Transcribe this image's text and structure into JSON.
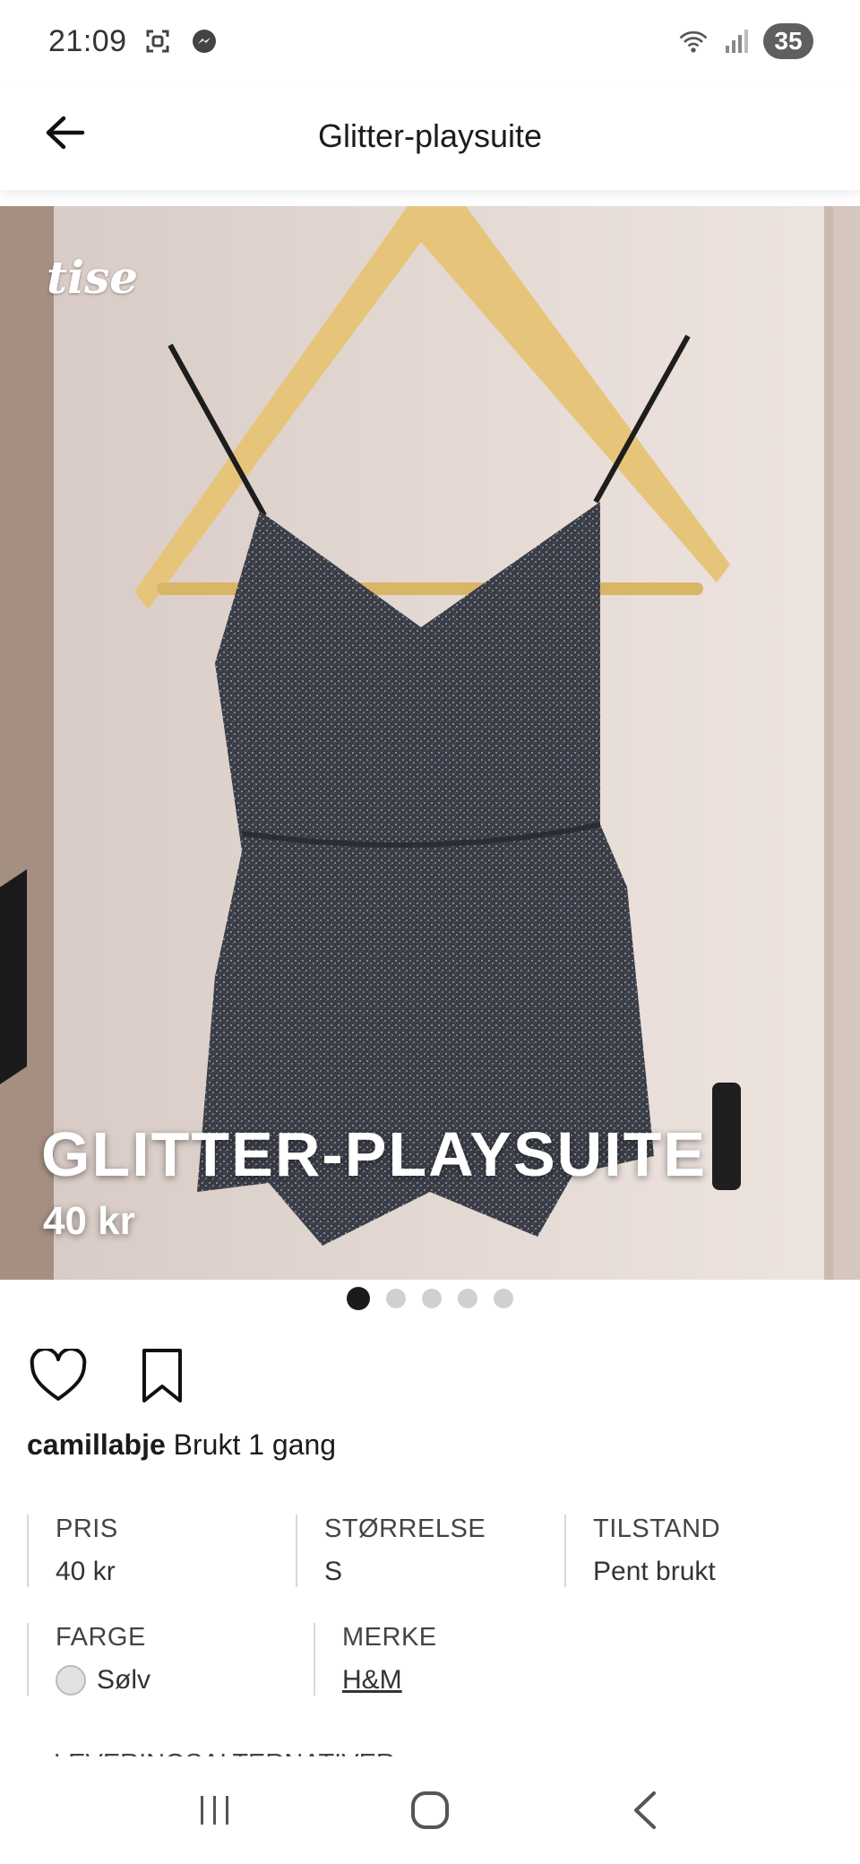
{
  "status_bar": {
    "time": "21:09",
    "battery": "35",
    "icons": [
      "screenshot-icon",
      "messenger-icon",
      "wifi-icon",
      "signal-icon"
    ]
  },
  "app_bar": {
    "title": "Glitter-playsuite",
    "back_icon": "arrow-left-icon"
  },
  "hero": {
    "watermark": "tise",
    "title": "GLITTER-PLAYSUITE",
    "price": "40 kr"
  },
  "carousel": {
    "count": 5,
    "active_index": 0
  },
  "actions": {
    "like_icon": "heart-icon",
    "save_icon": "bookmark-icon"
  },
  "seller": {
    "username": "camillabje",
    "note": "Brukt 1 gang"
  },
  "details": {
    "price": {
      "label": "PRIS",
      "value": "40 kr"
    },
    "size": {
      "label": "STØRRELSE",
      "value": "S"
    },
    "condition": {
      "label": "TILSTAND",
      "value": "Pent brukt"
    },
    "color": {
      "label": "FARGE",
      "value": "Sølv",
      "swatch": "#e2e2e2"
    },
    "brand": {
      "label": "MERKE",
      "value": "H&M"
    },
    "delivery_label": "LEVERINGSALTERNATIVER"
  },
  "nav_bar": {
    "icons": [
      "recents-icon",
      "home-icon",
      "back-icon"
    ]
  }
}
